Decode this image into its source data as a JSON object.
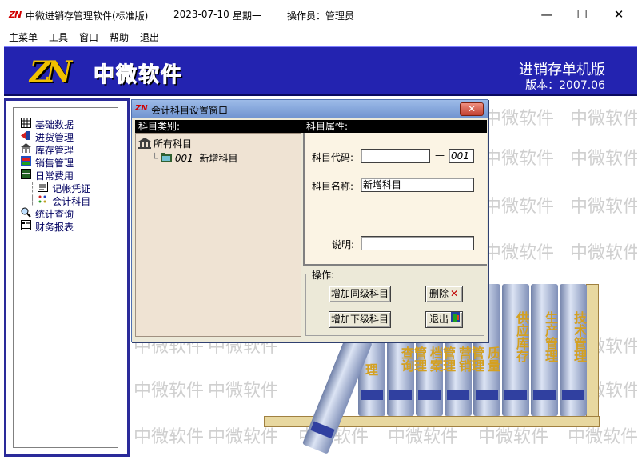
{
  "app": {
    "logo_text": "ZN",
    "title": "中微进销存管理软件(标准版)",
    "date": "2023-07-10",
    "weekday": "星期一",
    "operator": "操作员：管理员"
  },
  "window_controls": {
    "minimize": "—",
    "maximize": "☐",
    "close": "✕"
  },
  "menubar": [
    "主菜单",
    "工具",
    "窗口",
    "帮助",
    "退出"
  ],
  "banner": {
    "logo_text": "ZN",
    "brand": "中微软件",
    "edition": "进销存单机版",
    "version": "版本：2007.06"
  },
  "watermark": "中微软件",
  "nav": [
    {
      "label": "基础数据",
      "icon": "grid-icon"
    },
    {
      "label": "进货管理",
      "icon": "import-icon"
    },
    {
      "label": "库存管理",
      "icon": "warehouse-icon"
    },
    {
      "label": "销售管理",
      "icon": "sales-icon"
    },
    {
      "label": "日常费用",
      "icon": "expense-icon"
    },
    {
      "label": "记帐凭证",
      "icon": "voucher-icon"
    },
    {
      "label": "会计科目",
      "icon": "accounts-icon"
    },
    {
      "label": "统计查询",
      "icon": "query-icon"
    },
    {
      "label": "财务报表",
      "icon": "report-icon"
    }
  ],
  "books": [
    "技术管理",
    "生产管理",
    "供应库存",
    "质量管理",
    "营销管理",
    "档案管理",
    "查询",
    "理"
  ],
  "dialog": {
    "logo_text": "ZN",
    "title": "会计科目设置窗口",
    "close": "✕",
    "left_header": "科目类别:",
    "right_header": "科目属性:",
    "tree_root": "所有科目",
    "tree_child_code": "001",
    "tree_child_name": "新增科目",
    "code_label": "科目代码:",
    "code_value": "",
    "code_dash": "—",
    "code_suffix": "001",
    "name_label": "科目名称:",
    "name_value": "新增科目",
    "desc_label": "说明:",
    "desc_value": "",
    "ops_label": "操作:",
    "btn_add_same": "增加同级科目",
    "btn_add_child": "增加下级科目",
    "btn_delete": "删除",
    "btn_exit": "退出"
  },
  "colors": {
    "banner_bg": "#2323b0",
    "dialog_bg": "#ece9d8",
    "accent_red": "#d00000"
  }
}
